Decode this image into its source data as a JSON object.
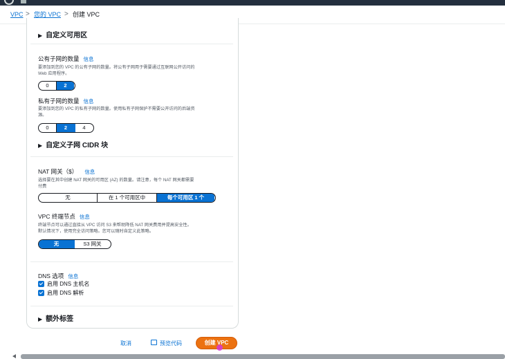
{
  "breadcrumb": {
    "items": [
      "VPC",
      "您的 VPC",
      "创建 VPC"
    ],
    "separator": ">"
  },
  "sections": {
    "custom_az": "自定义可用区",
    "public_subnets": {
      "label": "公有子网的数量",
      "info": "信息",
      "desc_line1": "要添加到您的 VPC 的公有子网的数量。将公有子网用于需要通过互联网公开访问的",
      "desc_line2": "Web 应用程序。",
      "options": [
        "0",
        "2"
      ],
      "selected": "2"
    },
    "private_subnets": {
      "label": "私有子网的数量",
      "info": "信息",
      "desc_line1": "要添加到您的 VPC 的私有子网的数量。使用私有子网保护不需要公开访问的后端资",
      "desc_line2": "源。",
      "options": [
        "0",
        "2",
        "4"
      ],
      "selected": "2"
    },
    "custom_cidr": "自定义子网 CIDR 块",
    "nat": {
      "label": "NAT 网关（$）",
      "info": "信息",
      "desc_line1": "选择要在其中创建 NAT 网关的可用区 (AZ) 的数量。请注意，每个 NAT 网关都需要",
      "desc_line2": "付费",
      "options": [
        "无",
        "在 1 个可用区中",
        "每个可用区 1 个"
      ],
      "selected": "每个可用区 1 个"
    },
    "endpoints": {
      "label": "VPC 终端节点",
      "info": "信息",
      "desc_line1": "终端节点可以通过直接从 VPC 访问 S3 来帮助降低 NAT 网关费用并提高安全性。",
      "desc_line2": "默认情况下，使用完全访问策略。您可以随时自定义此策略。",
      "options": [
        "无",
        "S3 网关"
      ],
      "selected": "无"
    },
    "dns": {
      "label": "DNS 选项",
      "info": "信息",
      "hostnames": "启用 DNS 主机名",
      "resolution": "启用 DNS 解析",
      "hostnames_checked": true,
      "resolution_checked": true
    },
    "tags": "额外标签"
  },
  "footer": {
    "cancel": "取消",
    "preview": "预览代码",
    "create": "创建 VPC"
  },
  "colors": {
    "accent": "#0972d3",
    "primary_button": "#ec7211",
    "header": "#232f3e"
  }
}
